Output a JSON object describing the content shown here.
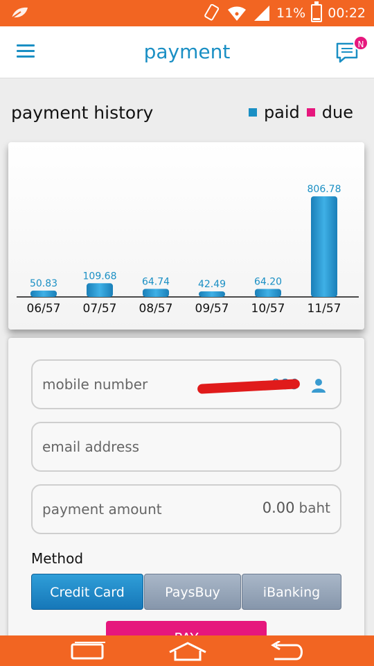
{
  "status_bar": {
    "battery": "11%",
    "time": "00:22",
    "icons": [
      "leaf-icon",
      "vibrate-icon",
      "wifi-icon",
      "signal-icon",
      "battery-icon"
    ]
  },
  "app_bar": {
    "title": "payment",
    "menu_icon": "hamburger-menu-icon",
    "chat_icon": "chat-icon",
    "badge": "N"
  },
  "history": {
    "title": "payment history",
    "legend": [
      {
        "label": "paid",
        "color": "#1a8fc4"
      },
      {
        "label": "due",
        "color": "#e6177d"
      }
    ]
  },
  "chart_data": {
    "type": "bar",
    "categories": [
      "06/57",
      "07/57",
      "08/57",
      "09/57",
      "10/57",
      "11/57"
    ],
    "series": [
      {
        "name": "paid",
        "values": [
          50.83,
          109.68,
          64.74,
          42.49,
          64.2,
          806.78
        ]
      }
    ],
    "value_labels": [
      "50.83",
      "109.68",
      "64.74",
      "42.49",
      "64.20",
      "806.78"
    ],
    "bar_color": "#1a8fc4",
    "ylim": [
      0,
      806.78
    ]
  },
  "form": {
    "mobile": {
      "label": "mobile number",
      "value": "089"
    },
    "email": {
      "label": "email address"
    },
    "amount": {
      "label": "payment amount",
      "value": "0.00",
      "unit": "baht"
    },
    "method_label": "Method",
    "methods": [
      "Credit Card",
      "PaysBuy",
      "iBanking"
    ],
    "active_method": "Credit Card",
    "pay_button": "PAY"
  },
  "nav_bar": {
    "icons": [
      "recent-apps-icon",
      "home-icon",
      "back-icon"
    ]
  },
  "colors": {
    "accent": "#1a8fc4",
    "status_bar": "#f26522",
    "pink": "#e6177d"
  }
}
